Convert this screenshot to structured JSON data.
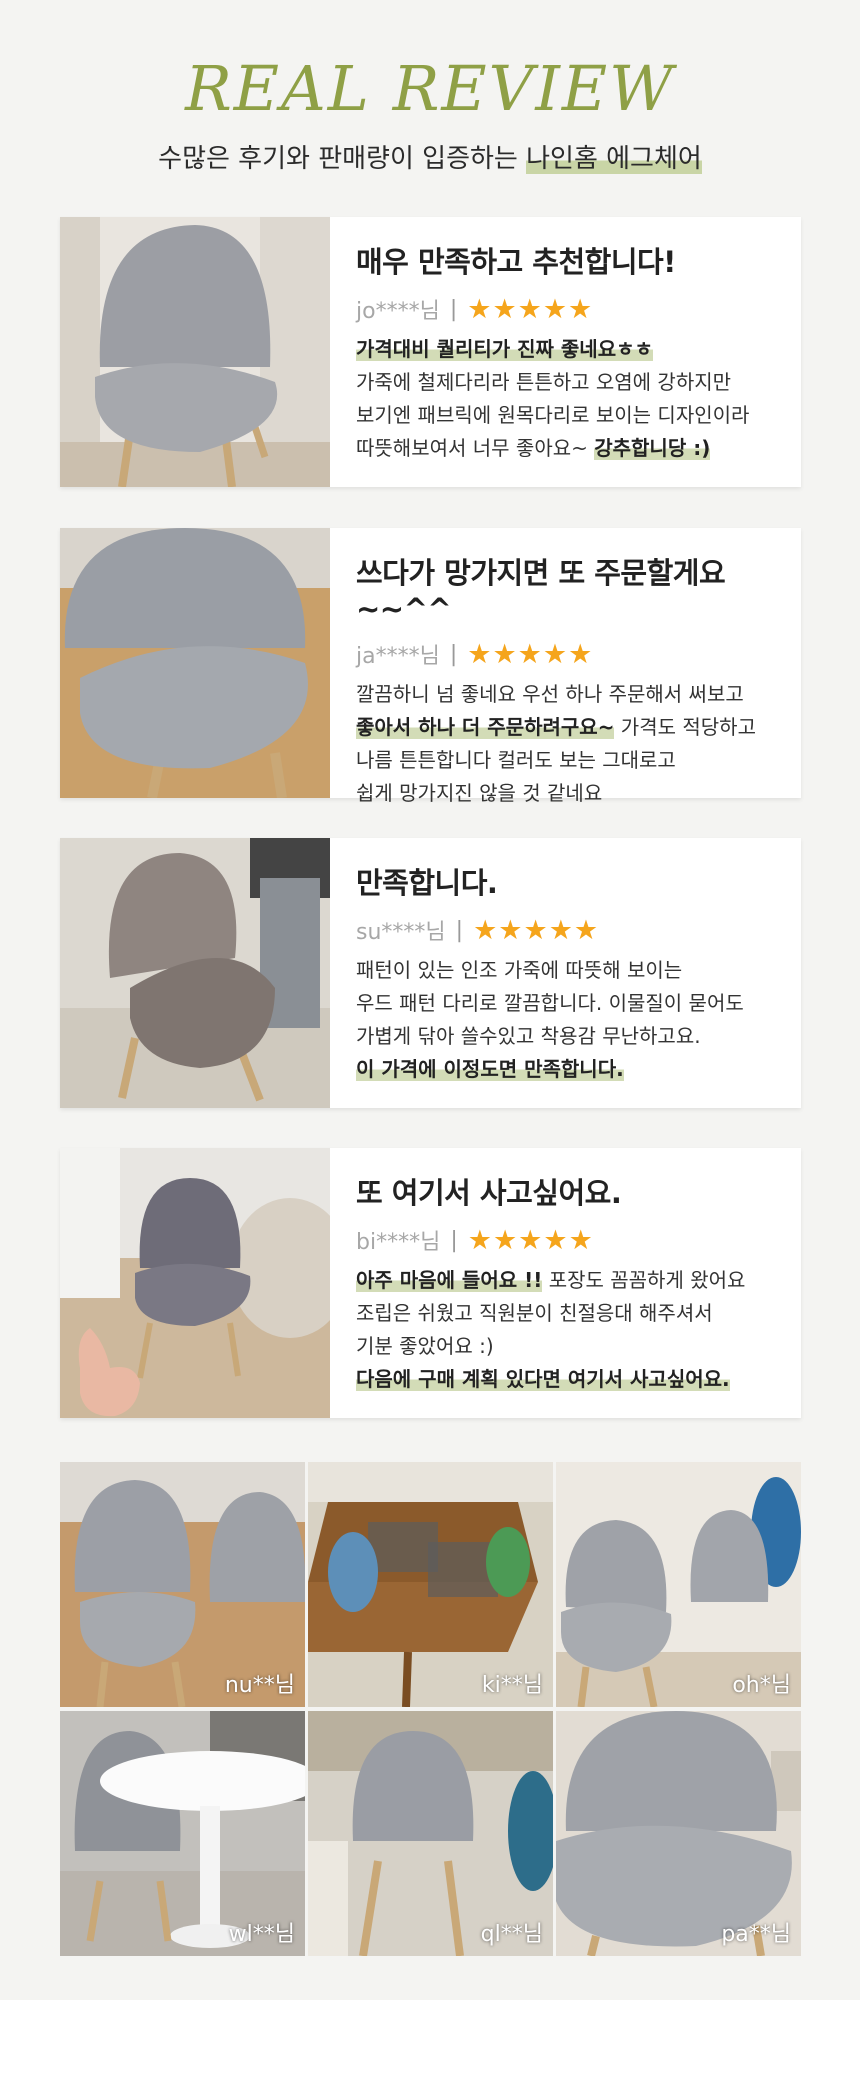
{
  "header": {
    "title": "REAL REVIEW",
    "subtitle_prefix": "수많은 후기와 판매량이 입증하는 ",
    "subtitle_highlight": "나인홈 에그체어"
  },
  "reviews": [
    {
      "title": "매우 만족하고 추천합니다!",
      "user": "jo****님",
      "stars": "★★★★★",
      "rating": 5,
      "lines": [
        {
          "text": "가격대비 퀄리티가 진짜 좋네요ㅎㅎ",
          "highlight": true
        },
        {
          "text": "가죽에 철제다리라 튼튼하고 오염에 강하지만",
          "highlight": false
        },
        {
          "text": "보기엔 패브릭에 원목다리로 보이는 디자인이라",
          "highlight": false
        },
        {
          "pre": "따뜻해보여서 너무 좋아요~ ",
          "hl": "강추합니당 :)"
        }
      ]
    },
    {
      "title": "쓰다가 망가지면 또 주문할게요~~^^",
      "user": "ja****님",
      "stars": "★★★★★",
      "rating": 5,
      "lines": [
        {
          "text": "깔끔하니 넘 좋네요 우선 하나 주문해서 써보고",
          "highlight": false
        },
        {
          "hl": "좋아서 하나 더 주문하려구요~",
          "post": " 가격도 적당하고"
        },
        {
          "text": "나름 튼튼합니다 컬러도 보는 그대로고",
          "highlight": false
        },
        {
          "text": "쉽게 망가지진 않을 것 같네요",
          "highlight": false
        }
      ]
    },
    {
      "title": "만족합니다.",
      "user": "su****님",
      "stars": "★★★★★",
      "rating": 5,
      "lines": [
        {
          "text": "패턴이 있는 인조 가죽에 따뜻해 보이는",
          "highlight": false
        },
        {
          "text": "우드 패턴 다리로 깔끔합니다. 이물질이 묻어도",
          "highlight": false
        },
        {
          "text": "가볍게 닦아 쓸수있고 착용감 무난하고요.",
          "highlight": false
        },
        {
          "text": "이 가격에 이정도면 만족합니다.",
          "highlight": true
        }
      ]
    },
    {
      "title": "또 여기서 사고싶어요.",
      "user": "bi****님",
      "stars": "★★★★★",
      "rating": 5,
      "lines": [
        {
          "hl": "아주 마음에 들어요 !!",
          "post": " 포장도 꼼꼼하게 왔어요"
        },
        {
          "text": "조립은 쉬웠고 직원분이 친절응대 해주셔서",
          "highlight": false
        },
        {
          "text": "기분 좋았어요 :)",
          "highlight": false
        },
        {
          "text": "다음에 구매 계획 있다면 여기서 사고싶어요.",
          "highlight": true
        }
      ]
    }
  ],
  "gallery": [
    {
      "tag": "nu**님"
    },
    {
      "tag": "ki**님"
    },
    {
      "tag": "oh*님"
    },
    {
      "tag": "wl**님"
    },
    {
      "tag": "ql**님"
    },
    {
      "tag": "pa**님"
    }
  ],
  "colors": {
    "title_green": "#8fa046",
    "highlight_green": "#d3dcb7",
    "star_yellow": "#f5a51c",
    "background": "#f4f4f2"
  }
}
